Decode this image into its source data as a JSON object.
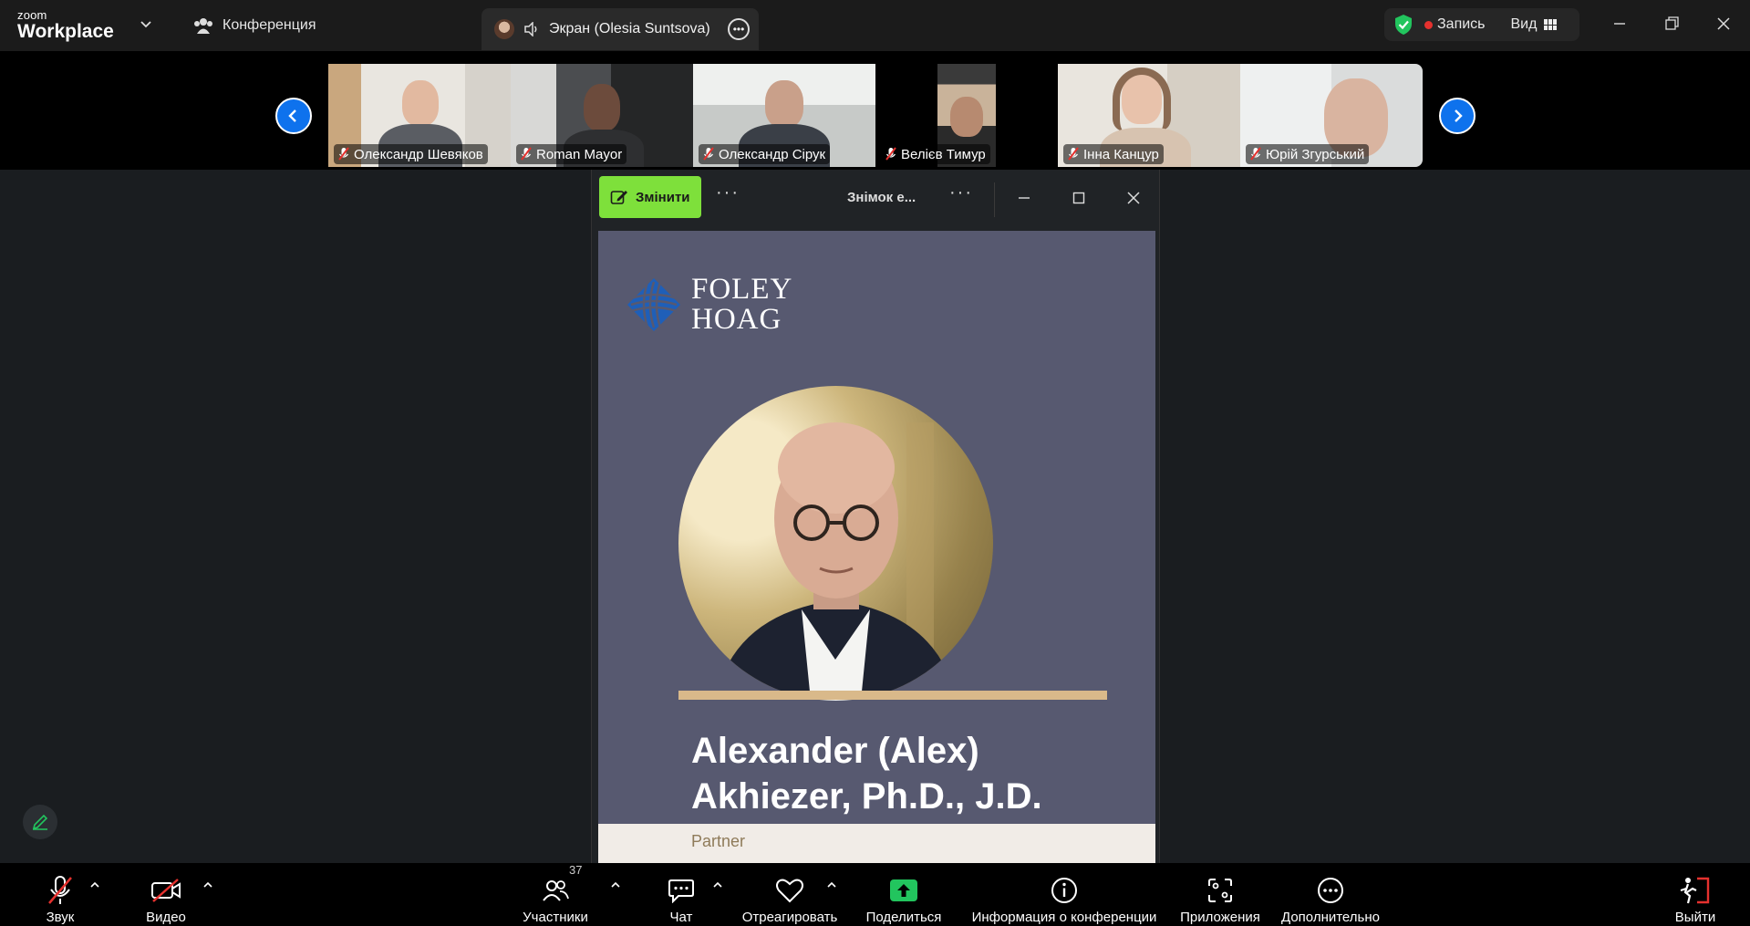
{
  "app": {
    "brand_small": "zoom",
    "brand_big": "Workplace",
    "conference_tab": "Конференция",
    "screen_tab": "Экран (Olesia Suntsova)",
    "record_label": "Запись",
    "view_label": "Вид"
  },
  "participants": [
    {
      "name": "Олександр Шевяков",
      "muted": true
    },
    {
      "name": "Roman Mayor",
      "muted": true
    },
    {
      "name": "Олександр Сірук",
      "muted": true
    },
    {
      "name": "Велієв Тимур",
      "muted": true
    },
    {
      "name": "Інна Канцур",
      "muted": true
    },
    {
      "name": "Юрій Згурський",
      "muted": true
    }
  ],
  "share_window": {
    "edit_label": "Змінити",
    "title": "Знімок е..."
  },
  "slide": {
    "logo_line1": "FOLEY",
    "logo_line2": "HOAG",
    "name_line1": "Alexander (Alex)",
    "name_line2": "Akhiezer, Ph.D., J.D.",
    "role": "Partner"
  },
  "toolbar": {
    "audio": "Звук",
    "video": "Видео",
    "participants": "Участники",
    "participants_count": "37",
    "chat": "Чат",
    "react": "Отреагировать",
    "share": "Поделиться",
    "info": "Информация о конференции",
    "apps": "Приложения",
    "more": "Дополнительно",
    "leave": "Выйти"
  },
  "colors": {
    "accent_blue": "#0e72ed",
    "edit_green": "#7ee03b",
    "share_green": "#22c55e",
    "record_red": "#e5312e",
    "leave_red": "#e5312e",
    "slide_bg": "#575970"
  }
}
